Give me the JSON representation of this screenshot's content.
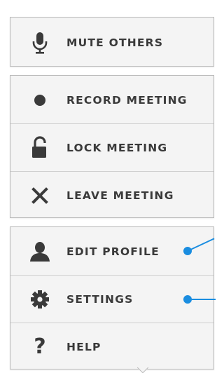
{
  "menu": {
    "top": {
      "mute_others": {
        "label": "MUTE OTHERS",
        "icon": "microphone-icon"
      }
    },
    "meeting": {
      "record": {
        "label": "RECORD MEETING",
        "icon": "record-dot-icon"
      },
      "lock": {
        "label": "LOCK MEETING",
        "icon": "padlock-icon"
      },
      "leave": {
        "label": "LEAVE MEETING",
        "icon": "close-icon"
      }
    },
    "account": {
      "edit_profile": {
        "label": "EDIT PROFILE",
        "icon": "user-icon"
      },
      "settings": {
        "label": "SETTINGS",
        "icon": "gear-icon"
      },
      "help": {
        "label": "HELP",
        "icon": "question-mark-icon"
      }
    }
  },
  "colors": {
    "panel_bg": "#f4f4f4",
    "panel_border": "#b9b9b9",
    "text": "#3a3a3a",
    "icon": "#3a3a3a",
    "annotation": "#1a8de0"
  }
}
